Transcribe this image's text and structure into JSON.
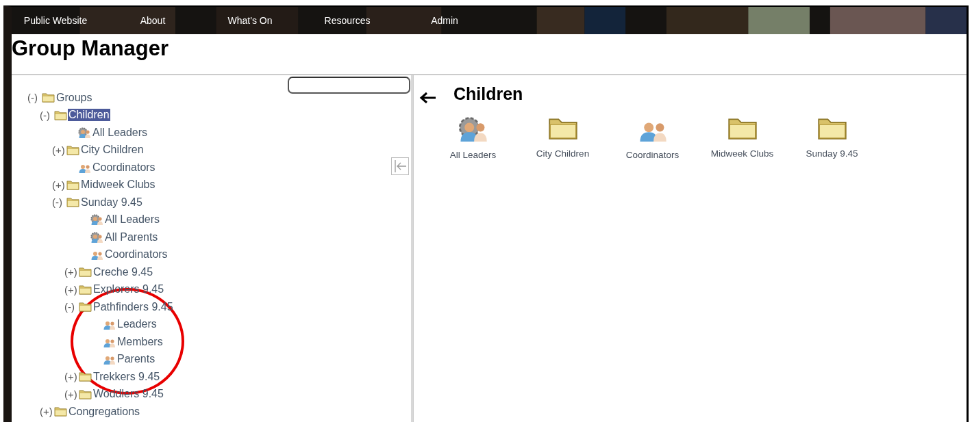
{
  "nav": [
    {
      "label": "Public Website"
    },
    {
      "label": "About"
    },
    {
      "label": "What's On"
    },
    {
      "label": "Resources"
    },
    {
      "label": "Admin"
    }
  ],
  "page_title": "Group Manager",
  "tree": [
    {
      "label": "Groups",
      "kind": "folder",
      "toggle": "(-)",
      "selected": false,
      "children": [
        {
          "label": "Children",
          "kind": "folder",
          "toggle": "(-)",
          "selected": true,
          "children": [
            {
              "label": "All Leaders",
              "kind": "leaders",
              "selected": false
            },
            {
              "label": "City Children",
              "kind": "folder",
              "toggle": "(+)",
              "selected": false
            },
            {
              "label": "Coordinators",
              "kind": "group",
              "selected": false
            },
            {
              "label": "Midweek Clubs",
              "kind": "folder",
              "toggle": "(+)",
              "selected": false
            },
            {
              "label": "Sunday 9.45",
              "kind": "folder",
              "toggle": "(-)",
              "selected": false,
              "children": [
                {
                  "label": "All Leaders",
                  "kind": "leaders",
                  "selected": false
                },
                {
                  "label": "All Parents",
                  "kind": "leaders",
                  "selected": false
                },
                {
                  "label": "Coordinators",
                  "kind": "group",
                  "selected": false
                },
                {
                  "label": "Creche 9.45",
                  "kind": "folder",
                  "toggle": "(+)",
                  "selected": false
                },
                {
                  "label": "Explorers 9.45",
                  "kind": "folder",
                  "toggle": "(+)",
                  "selected": false
                },
                {
                  "label": "Pathfinders 9.45",
                  "kind": "folder",
                  "toggle": "(-)",
                  "selected": false,
                  "children": [
                    {
                      "label": "Leaders",
                      "kind": "group",
                      "selected": false
                    },
                    {
                      "label": "Members",
                      "kind": "group",
                      "selected": false
                    },
                    {
                      "label": "Parents",
                      "kind": "group",
                      "selected": false
                    }
                  ]
                },
                {
                  "label": "Trekkers 9.45",
                  "kind": "folder",
                  "toggle": "(+)",
                  "selected": false
                },
                {
                  "label": "Woddlers 9.45",
                  "kind": "folder",
                  "toggle": "(+)",
                  "selected": false
                }
              ]
            }
          ]
        },
        {
          "label": "Congregations",
          "kind": "folder",
          "toggle": "(+)",
          "selected": false
        }
      ]
    }
  ],
  "detail": {
    "title": "Children",
    "items": [
      {
        "label": "All Leaders",
        "kind": "leaders"
      },
      {
        "label": "City Children",
        "kind": "folder"
      },
      {
        "label": "Coordinators",
        "kind": "group"
      },
      {
        "label": "Midweek Clubs",
        "kind": "folder"
      },
      {
        "label": "Sunday 9.45",
        "kind": "folder"
      }
    ]
  }
}
